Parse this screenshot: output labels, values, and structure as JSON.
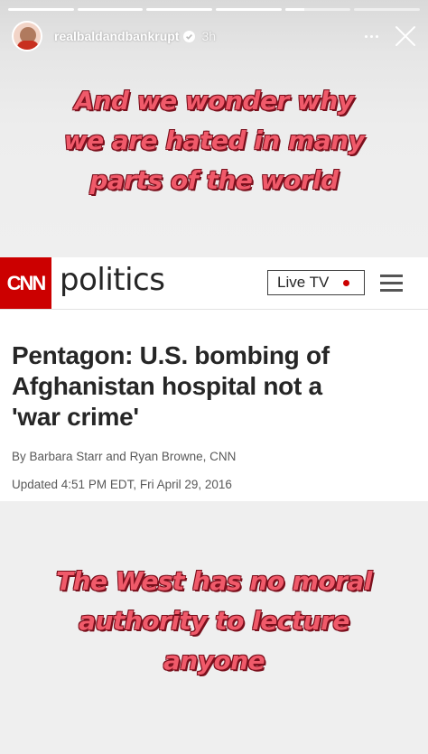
{
  "story": {
    "progress": [
      1,
      1,
      1,
      1,
      0.3,
      0
    ],
    "username": "realbaldandbankrupt",
    "verified_icon": "verified-badge-icon",
    "time": "3h",
    "more_icon": "more-options-icon",
    "close_icon": "close-icon"
  },
  "caption_top": {
    "lines": [
      "And we wonder why",
      "we are hated in many",
      "parts of the world"
    ],
    "color": "#f05a6a"
  },
  "article": {
    "logo_text": "CNN",
    "section": "politics",
    "live_tv_label": "Live TV",
    "headline_lines": [
      "Pentagon: U.S. bombing of",
      "Afghanistan hospital not a",
      "'war crime'"
    ],
    "byline": "By Barbara Starr and Ryan Browne, CNN",
    "updated": "Updated 4:51 PM EDT, Fri April 29, 2016",
    "brand_color": "#cc0000"
  },
  "caption_bottom": {
    "lines": [
      "The West has no moral",
      "authority to lecture",
      "anyone"
    ],
    "color": "#f05a6a"
  }
}
